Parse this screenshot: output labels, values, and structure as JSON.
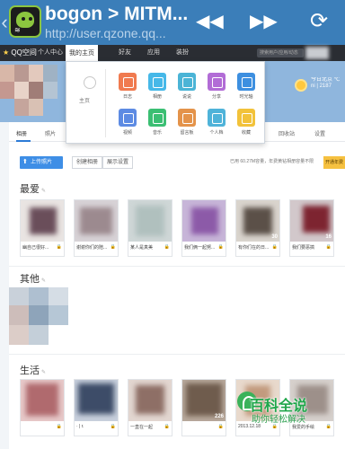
{
  "browser": {
    "title": "bogon > MITM...",
    "url": "http://user.qzone.qq...",
    "back_icon": "chevron-left-icon",
    "rewind_icon": "rewind-icon",
    "forward_icon": "fast-forward-icon",
    "refresh_icon": "refresh-icon"
  },
  "qzone": {
    "logo": "QQ空间",
    "tabs": [
      "个人中心",
      "我的主页",
      "好友",
      "应用",
      "装扮"
    ],
    "search_placeholder": "搜索用户/应用/动态"
  },
  "app_panel": {
    "home_label": "主页",
    "apps": [
      {
        "label": "日志",
        "color": "#f07a4f"
      },
      {
        "label": "相册",
        "color": "#46b8e8"
      },
      {
        "label": "说说",
        "color": "#4bb4d6"
      },
      {
        "label": "分享",
        "color": "#b26cd6"
      },
      {
        "label": "时光轴",
        "color": "#3d8fe0"
      },
      {
        "label": "视频",
        "color": "#5d8be3"
      },
      {
        "label": "音乐",
        "color": "#3bbf73"
      },
      {
        "label": "留言板",
        "color": "#e4934a"
      },
      {
        "label": "个人档",
        "color": "#4fb3d9"
      },
      {
        "label": "收藏",
        "color": "#f2c23a"
      }
    ]
  },
  "tabs": {
    "items": [
      "相册",
      "照片",
      "回收站",
      "设置"
    ],
    "active": "相册"
  },
  "toolbar": {
    "upload": "上传照片",
    "create_album": "创建相册",
    "display_settings": "展示设置",
    "storage_text": "已用 60.27M容量，年费黄钻相册容量不限",
    "storage_btn": "开通年费"
  },
  "sections": [
    {
      "title": "最爱",
      "edit_icon": "pencil-icon"
    },
    {
      "title": "其他",
      "edit_icon": "pencil-icon"
    },
    {
      "title": "生活",
      "edit_icon": "pencil-icon"
    }
  ],
  "albums_favorite": [
    {
      "caption": "幽自己很好...",
      "count": ""
    },
    {
      "caption": "谢谢你们的陪...",
      "count": ""
    },
    {
      "caption": "某人是真美",
      "count": ""
    },
    {
      "caption": "我们俩一起努...",
      "count": ""
    },
    {
      "caption": "有你们在的日...",
      "count": "30"
    },
    {
      "caption": "我们要恶搞",
      "count": "16"
    }
  ],
  "albums_life": [
    {
      "caption": "",
      "count": ""
    },
    {
      "caption": "· | r.",
      "count": ""
    },
    {
      "caption": "一直在一起",
      "count": ""
    },
    {
      "caption": "",
      "count": "226"
    },
    {
      "caption": "2013.12.18",
      "count": ""
    },
    {
      "caption": "我爱的手绘",
      "count": ""
    }
  ],
  "watermark": {
    "title": "百科全说",
    "subtitle": "助你轻松解决"
  }
}
